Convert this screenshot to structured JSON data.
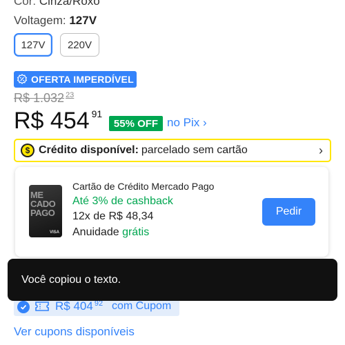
{
  "product": {
    "color_label": "Cor:",
    "color_value": "Cinza/Roxo",
    "voltage_label": "Voltagem:",
    "voltage_value": "127V",
    "voltage_options": [
      "127V",
      "220V"
    ]
  },
  "offer_badge": "OFERTA IMPERDÍVEL",
  "prices": {
    "old_integer": "R$ 1.032",
    "old_cents": "23",
    "current_integer": "R$ 454",
    "current_cents": "91",
    "discount": "55% OFF",
    "pix": "no Pix ›"
  },
  "credit": {
    "icon_symbol": "$",
    "title": "Crédito disponível:",
    "subtitle": "parcelado sem cartão",
    "chevron": "›"
  },
  "card_offer": {
    "card_art_text": "ME\nCADO\nPAGO",
    "card_brand": "VISA",
    "title": "Cartão de Crédito Mercado Pago",
    "cashback": "Até 3% de cashback",
    "installments": "12x de R$ 48,34",
    "annual_fee_label": "Anuidade",
    "annual_fee_value": "grátis",
    "button": "Pedir"
  },
  "toast": "Você copiou o texto.",
  "coupon": {
    "price_integer": "R$ 404",
    "price_cents": "92",
    "label": "com Cupom"
  },
  "coupons_link": "Ver cupons disponíveis",
  "colors": {
    "accent": "#3483fa",
    "green": "#00a650",
    "yellow": "#ffe600"
  }
}
